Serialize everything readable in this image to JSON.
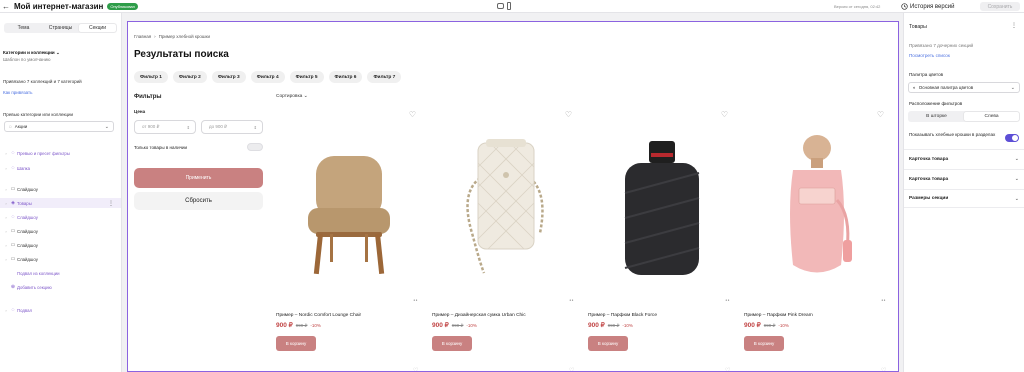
{
  "topbar": {
    "back_icon": "←",
    "title": "Мой интернет-магазин",
    "badge": "Опубликован",
    "saved": "Версия от сегодня, 02:42",
    "history_label": "История версий",
    "save_label": "Сохранить"
  },
  "left": {
    "tabs": [
      "Тема",
      "Страницы",
      "Секции"
    ],
    "section_title": "Категории и коллекции",
    "template": "Шаблон по умолчанию",
    "bound": "Привязано 7 коллекций и 7 категорий",
    "how_link": "Как привязать",
    "preview_label": "Превью категории или коллекции",
    "preview_value": "Акции",
    "tree": [
      {
        "label": "Превью и пресет фильтры",
        "purple": true
      },
      {
        "label": "Шапка",
        "purple": true
      },
      {
        "label": "Слайдшоу",
        "purple": false
      },
      {
        "label": "Товары",
        "purple": true,
        "selected": true
      },
      {
        "label": "Слайдшоу",
        "purple": true
      },
      {
        "label": "Слайдшоу",
        "purple": false
      },
      {
        "label": "Слайдшоу",
        "purple": false
      },
      {
        "label": "Слайдшоу",
        "purple": false
      },
      {
        "label": "Подвал из коллекции",
        "purple": true
      }
    ],
    "add_section": "Добавить секцию",
    "footer": "Подвал"
  },
  "canvas": {
    "crumb_home": "Главная",
    "crumb_sep": "›",
    "crumb_current": "Пример хлебной крошки",
    "title": "Результаты поиска",
    "chips": [
      "Фильтр 1",
      "Фильтр 2",
      "Фильтр 3",
      "Фильтр 4",
      "Фильтр 5",
      "Фильтр 6",
      "Фильтр 7"
    ],
    "filters_title": "Фильтры",
    "price_label": "Цена",
    "price_from": "от 900 ₽",
    "price_to": "до 900 ₽",
    "stock_label": "Только товары в наличии",
    "apply": "Применить",
    "reset": "Сбросить",
    "sort": "Сортировка",
    "products": [
      {
        "name": "Пример – Nordic Comfort Lounge Chair",
        "price": "900 ₽",
        "old": "999 ₽",
        "disc": "-10%",
        "cart": "В корзину"
      },
      {
        "name": "Пример – Дизайнерская сумка Urban Chic",
        "price": "900 ₽",
        "old": "999 ₽",
        "disc": "-10%",
        "cart": "В корзину"
      },
      {
        "name": "Пример – Парфюм Black Force",
        "price": "900 ₽",
        "old": "999 ₽",
        "disc": "-10%",
        "cart": "В корзину"
      },
      {
        "name": "Пример – Парфюм Pink Dream",
        "price": "900 ₽",
        "old": "999 ₽",
        "disc": "-10%",
        "cart": "В корзину"
      }
    ]
  },
  "right": {
    "title": "Товары",
    "bound": "Привязано 7 дочерних секций",
    "view_list": "Посмотреть список",
    "palette_label": "Палитра цветов",
    "palette_value": "Основная палитра цветов",
    "filters_pos_label": "Расположение фильтров",
    "filters_pos": [
      "В шторке",
      "Слева"
    ],
    "breadcrumbs_toggle": "Показывать хлебные крошки в разделах",
    "accordions": [
      "Карточка товара",
      "Карточка товара",
      "Размеры секции"
    ]
  }
}
